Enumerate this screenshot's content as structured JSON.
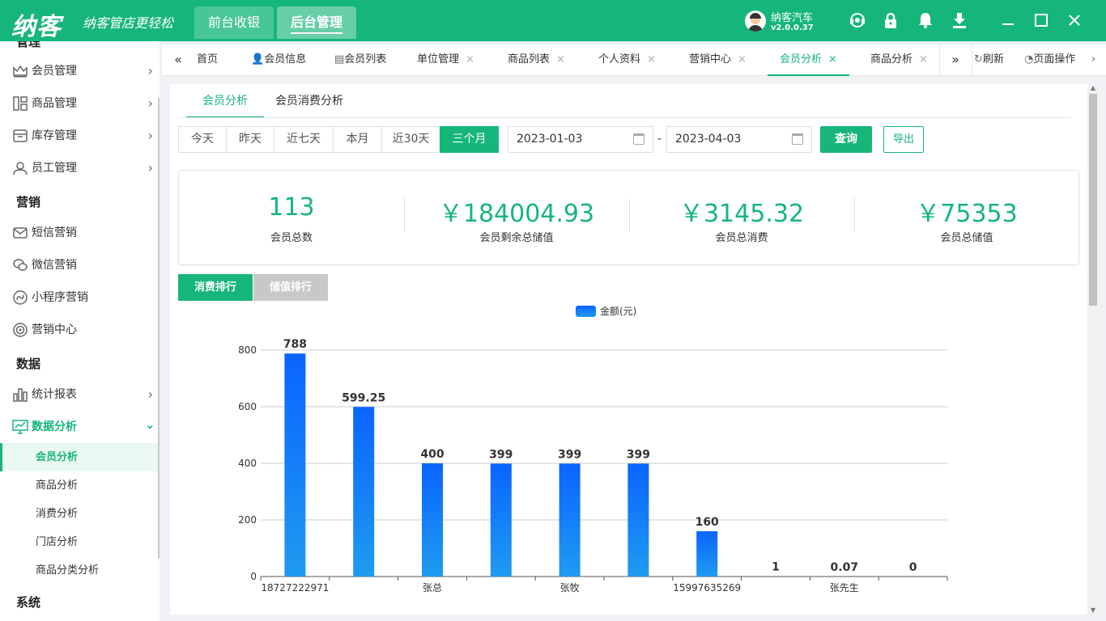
{
  "app": {
    "logo": "纳客",
    "slogan": "纳客管店更轻松",
    "nav": [
      "前台收银",
      "后台管理"
    ],
    "user_name": "纳客汽车",
    "version": "v2.0.0.37",
    "icons": [
      "headset-icon",
      "lock-icon",
      "bell-icon",
      "download-icon",
      "minimize-icon",
      "maximize-icon",
      "close-icon"
    ]
  },
  "sidebar": {
    "top_cut": "管理",
    "items": [
      {
        "label": "会员管理",
        "icon": "crown-icon"
      },
      {
        "label": "商品管理",
        "icon": "grid-icon"
      },
      {
        "label": "库存管理",
        "icon": "box-icon"
      },
      {
        "label": "员工管理",
        "icon": "user-icon"
      }
    ],
    "sec_marketing": "营销",
    "marketing": [
      {
        "label": "短信营销",
        "icon": "mail-icon"
      },
      {
        "label": "微信营销",
        "icon": "wechat-icon"
      },
      {
        "label": "小程序营销",
        "icon": "miniprogram-icon"
      },
      {
        "label": "营销中心",
        "icon": "target-icon"
      }
    ],
    "sec_data": "数据",
    "data_items": [
      {
        "label": "统计报表",
        "icon": "bar-chart-icon"
      },
      {
        "label": "数据分析",
        "icon": "monitor-chart-icon"
      }
    ],
    "sub_items": [
      "会员分析",
      "商品分析",
      "消费分析",
      "门店分析",
      "商品分类分析"
    ],
    "sec_system": "系统"
  },
  "tabs": {
    "items": [
      "首页",
      "会员信息",
      "会员列表",
      "单位管理",
      "商品列表",
      "个人资料",
      "营销中心",
      "会员分析",
      "商品分析"
    ],
    "close": "×",
    "refresh": "刷新",
    "page_ops": "页面操作"
  },
  "page": {
    "subtabs": [
      "会员分析",
      "会员消费分析"
    ],
    "ranges": [
      "今天",
      "昨天",
      "近七天",
      "本月",
      "近30天",
      "三个月"
    ],
    "start_date": "2023-01-03",
    "end_date": "2023-04-03",
    "date_sep": "-",
    "query_label": "查询",
    "export_label": "导出",
    "stats": [
      {
        "value": "113",
        "label": "会员总数"
      },
      {
        "value": "￥184004.93",
        "label": "会员剩余总储值"
      },
      {
        "value": "￥3145.32",
        "label": "会员总消费"
      },
      {
        "value": "￥75353",
        "label": "会员总储值"
      }
    ],
    "rank_tabs": [
      "消费排行",
      "储值排行"
    ]
  },
  "colors": {
    "brand": "#16b67a",
    "bar_top": "#0a64ff",
    "bar_bottom": "#1f9bf0"
  },
  "chart_data": {
    "type": "bar",
    "legend": "金额(元)",
    "series": [
      {
        "name": "金额(元)",
        "values": [
          788,
          599.25,
          400,
          399,
          399,
          399,
          160,
          1,
          0.07,
          0
        ]
      }
    ],
    "x_tick_labels": [
      "18727222971",
      "张总",
      "张牧",
      "15997635269",
      "张先生"
    ],
    "x_label_index": [
      0,
      2,
      4,
      6,
      8
    ],
    "yticks": [
      0,
      200,
      400,
      600,
      800
    ],
    "ylim": [
      0,
      800
    ],
    "data_labels": [
      "788",
      "599.25",
      "400",
      "399",
      "399",
      "399",
      "160",
      "1",
      "0.07",
      "0"
    ],
    "grid": true
  }
}
